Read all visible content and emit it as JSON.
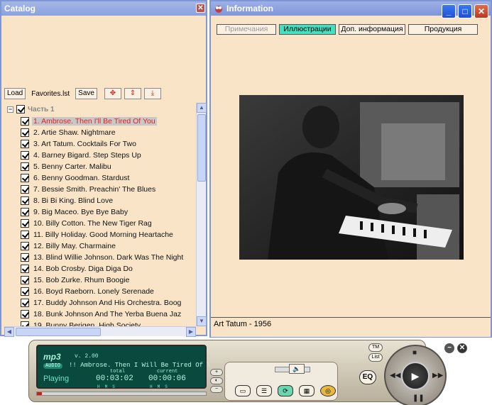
{
  "catalog": {
    "title": "Catalog",
    "toolbar": {
      "load": "Load",
      "playlist": "Favorites.lst",
      "save": "Save"
    },
    "root_label": "Часть 1",
    "tracks": [
      "1. Ambrose. Then I'll Be Tired Of You",
      "2. Artie Shaw. Nightmare",
      "3. Art Tatum. Cocktails For Two",
      "4. Barney Bigard. Step Steps Up",
      "5. Benny Carter. Malibu",
      "6. Benny Goodman. Stardust",
      "7. Bessie Smith. Preachin' The Blues",
      "8. Bi Bi King. Blind Love",
      "9. Big Maceo. Bye Bye Baby",
      "10. Billy Cotton. The New Tiger Rag",
      "11. Billy Holiday. Good Morning Heartache",
      "12. Billy May. Charmaine",
      "13. Blind Willie Johnson. Dark Was The Night",
      "14. Bob Crosby. Diga Diga Do",
      "15. Bob Zurke. Rhum Boogie",
      "16. Boyd Raeborn. Lonely Serenade",
      "17. Buddy Johnson And His Orchestra. Boog",
      "18. Bunk Johnson And The Yerba Buena Jaz",
      "19. Bunny Berigen. High Society"
    ],
    "selected_index": 0
  },
  "info": {
    "title": "Information",
    "tabs": [
      "Примечания",
      "Иллюстрации",
      "Доп. информация",
      "Продукция"
    ],
    "active_tab": 1,
    "caption": "Art Tatum - 1956"
  },
  "player": {
    "logo": "mp3",
    "audio_badge": "AUDIO",
    "version": "v. 2.00",
    "scroller": "!! Ambrose. Then I Will Be Tired Of \\",
    "status": "Playing",
    "total_label": "total",
    "total": "00:03:02",
    "current_label": "current",
    "current": "00:00:06",
    "hms": "HMS",
    "progress": 0.03,
    "eq": "EQ",
    "tm": "TM",
    "list": "List"
  },
  "colors": {
    "window_bg": "#f9e4c8",
    "title_blue": "#8aa1dd",
    "active_tab": "#44e0c0",
    "selected_text": "#e02020",
    "lcd_bg": "#0a4a3e"
  }
}
